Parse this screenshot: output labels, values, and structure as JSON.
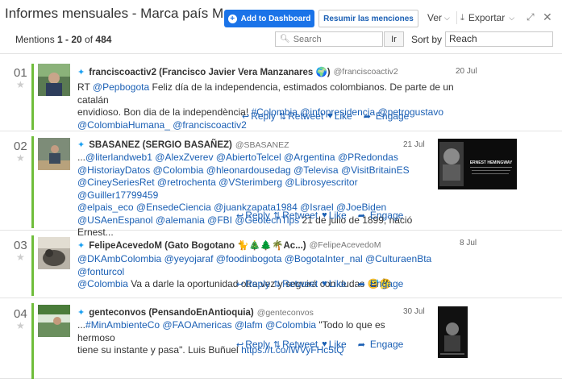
{
  "header": {
    "title": "Informes mensuales - Marca país Me...",
    "add_dashboard": "Add to Dashboard",
    "summarize": "Resumir las menciones",
    "view": "Ver",
    "export": "Exportar"
  },
  "toolbar": {
    "mentions_prefix": "Mentions ",
    "range": "1 - 20",
    "of": " of ",
    "total": "484",
    "search_placeholder": "Search",
    "go": "Ir",
    "sort_label": "Sort by",
    "sort_value": "Reach"
  },
  "actions": {
    "reply": "Reply",
    "retweet": "Retweet",
    "like": "Like",
    "engage": "Engage"
  },
  "mentions": [
    {
      "num": "01",
      "name": "franciscoactiv2 (Francisco Javier Vera Manzanares 🌍)",
      "handle": "@franciscoactiv2",
      "date": "20 Jul",
      "lines": [
        [
          {
            "t": "RT "
          },
          {
            "l": "@Pepbogota"
          },
          {
            "t": " Feliz día de la independencia, estimados colombianos. De parte de un catalán"
          }
        ],
        [
          {
            "t": "envidioso. Bon dia de la independència! "
          },
          {
            "l": "#Colombia"
          },
          {
            "t": " "
          },
          {
            "l": "@infopresidencia"
          },
          {
            "t": " "
          },
          {
            "l": "@petrogustavo"
          }
        ],
        [
          {
            "l": "@ColombiaHumana_"
          },
          {
            "t": " "
          },
          {
            "l": "@franciscoactiv2"
          }
        ]
      ]
    },
    {
      "num": "02",
      "name": "SBASANEZ (SERGIO BASAÑEZ)",
      "handle": "@SBASANEZ",
      "date": "21 Jul",
      "lines": [
        [
          {
            "t": "..."
          },
          {
            "l": "@literlandweb1"
          },
          {
            "t": " "
          },
          {
            "l": "@AlexZverev"
          },
          {
            "t": " "
          },
          {
            "l": "@AbiertoTelcel"
          },
          {
            "t": " "
          },
          {
            "l": "@Argentina"
          },
          {
            "t": " "
          },
          {
            "l": "@PRedondas"
          }
        ],
        [
          {
            "l": "@HistoriayDatos"
          },
          {
            "t": " "
          },
          {
            "l": "@Colombia"
          },
          {
            "t": " "
          },
          {
            "l": "@hleonardousedag"
          },
          {
            "t": " "
          },
          {
            "l": "@Televisa"
          },
          {
            "t": " "
          },
          {
            "l": "@VisitBritainES"
          }
        ],
        [
          {
            "l": "@CineySeriesRet"
          },
          {
            "t": " "
          },
          {
            "l": "@retrochenta"
          },
          {
            "t": " "
          },
          {
            "l": "@VSterimberg"
          },
          {
            "t": " "
          },
          {
            "l": "@Librosyescritor"
          },
          {
            "t": " "
          },
          {
            "l": "@Guiller17799459"
          }
        ],
        [
          {
            "l": "@elpais_eco"
          },
          {
            "t": " "
          },
          {
            "l": "@EnsedeCiencia"
          },
          {
            "t": " "
          },
          {
            "l": "@juankzapata1984"
          },
          {
            "t": " "
          },
          {
            "l": "@Israel"
          },
          {
            "t": " "
          },
          {
            "l": "@JoeBiden"
          }
        ],
        [
          {
            "l": "@USAenEspanol"
          },
          {
            "t": " "
          },
          {
            "l": "@alemania"
          },
          {
            "t": " "
          },
          {
            "l": "@FBI"
          },
          {
            "t": " "
          },
          {
            "l": "@GeotechTips"
          },
          {
            "t": " 21 de julio de 1899, nació"
          }
        ],
        [
          {
            "t": "Ernest..."
          }
        ]
      ],
      "thumb_title": "ERNEST HEMINGWAY"
    },
    {
      "num": "03",
      "name": "FelipeAcevedoM (Gato Bogotano 🐈🎄🌲🌴Ac...)",
      "handle": "@FelipeAcevedoM",
      "date": "8 Jul",
      "lines": [
        [
          {
            "l": "@DKAmbColombia"
          },
          {
            "t": " "
          },
          {
            "l": "@yeyojaraf"
          },
          {
            "t": " "
          },
          {
            "l": "@foodinbogota"
          },
          {
            "t": " "
          },
          {
            "l": "@BogotaInter_nal"
          },
          {
            "t": " "
          },
          {
            "l": "@CulturaenBta"
          },
          {
            "t": " "
          },
          {
            "l": "@fonturcol"
          }
        ],
        [
          {
            "l": "@Colombia"
          },
          {
            "t": " Va a darle la oportunidad otra vez y seguirá con dudas 😅🤔"
          }
        ]
      ]
    },
    {
      "num": "04",
      "name": "genteconvos (PensandoEnAntioquia)",
      "handle": "@genteconvos",
      "date": "30 Jul",
      "lines": [
        [
          {
            "t": "..."
          },
          {
            "l": "#MinAmbienteCo"
          },
          {
            "t": " "
          },
          {
            "l": "@FAOAmericas"
          },
          {
            "t": " "
          },
          {
            "l": "@lafm"
          },
          {
            "t": " "
          },
          {
            "l": "@Colombia"
          },
          {
            "t": " \"Todo lo que es hermoso"
          }
        ],
        [
          {
            "t": "tiene su instante y pasa\". Luis Buñuel "
          },
          {
            "l": "https://t.co/lWVyFHc5tQ"
          }
        ]
      ]
    }
  ]
}
